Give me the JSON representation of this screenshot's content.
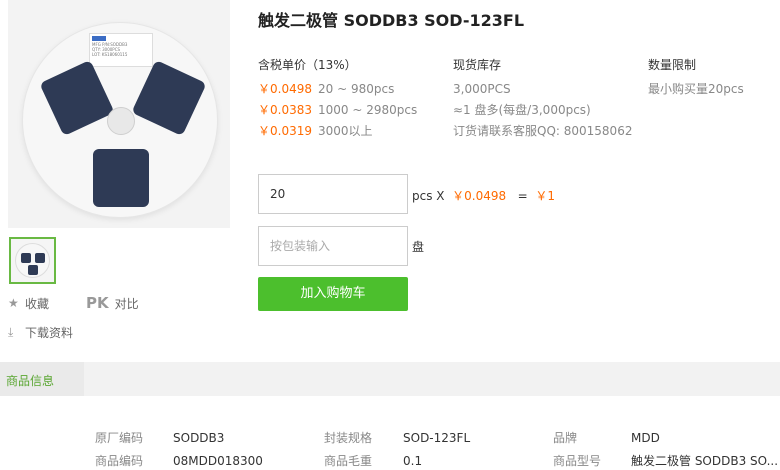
{
  "product": {
    "title": "触发二极管 SODDB3 SOD-123FL"
  },
  "sidebar": {
    "favorite_label": "收藏",
    "pk_label": "PK",
    "compare_label": "对比",
    "download_label": "下载资料"
  },
  "pricing": {
    "header": "含税单价（13%）",
    "tiers": [
      {
        "price": "￥0.0498",
        "range": "20 ~ 980pcs"
      },
      {
        "price": "￥0.0383",
        "range": "1000 ~ 2980pcs"
      },
      {
        "price": "￥0.0319",
        "range": "3000以上"
      }
    ]
  },
  "stock": {
    "header": "现货库存",
    "qty": "3,000PCS",
    "reels": "≈1 盘多(每盘/3,000pcs)",
    "contact": "订货请联系客服QQ: 800158062"
  },
  "limit": {
    "header": "数量限制",
    "min": "最小购买量20pcs"
  },
  "order": {
    "qty_value": "20",
    "pcs_x": "pcs X",
    "unit_price": "￥0.0498",
    "equals": "=",
    "total": "￥1",
    "pkg_placeholder": "按包装输入",
    "pkg_unit": "盘",
    "cart_button": "加入购物车"
  },
  "tabs": {
    "info": "商品信息"
  },
  "details": {
    "col1": [
      {
        "k": "原厂编码",
        "v": "SODDB3"
      },
      {
        "k": "商品编码",
        "v": "08MDD018300"
      }
    ],
    "col2": [
      {
        "k": "封装规格",
        "v": "SOD-123FL"
      },
      {
        "k": "商品毛重",
        "v": "0.1"
      }
    ],
    "col3": [
      {
        "k": "品牌",
        "v": "MDD"
      },
      {
        "k": "商品型号",
        "v": "触发二极管 SODDB3 SO..."
      }
    ]
  },
  "colors": {
    "accent_green": "#4cbf2d",
    "price_orange": "#ff6a00"
  }
}
